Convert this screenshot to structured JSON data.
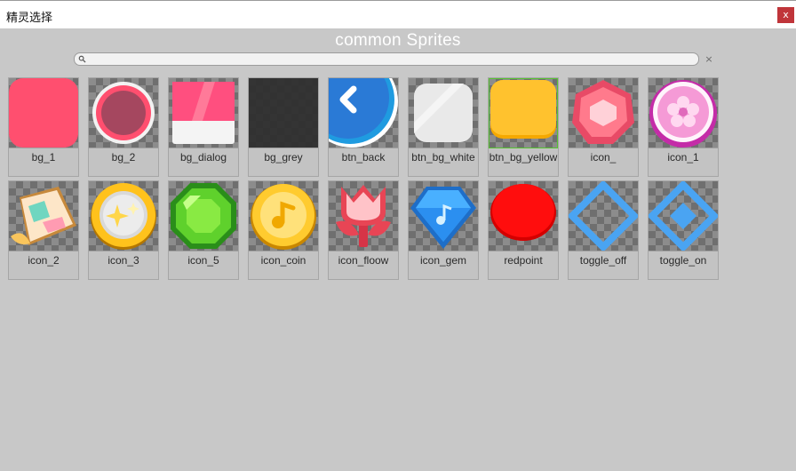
{
  "window": {
    "title": "精灵选择",
    "close_label": "x"
  },
  "heading": "common Sprites",
  "search": {
    "value": "",
    "clear_label": "×",
    "icon": "search-icon"
  },
  "sprites": [
    {
      "name": "bg_1",
      "icon": "bg-1-icon"
    },
    {
      "name": "bg_2",
      "icon": "bg-2-icon"
    },
    {
      "name": "bg_dialog",
      "icon": "bg-dialog-icon"
    },
    {
      "name": "bg_grey",
      "icon": "bg-grey-icon"
    },
    {
      "name": "btn_back",
      "icon": "back-arrow-icon"
    },
    {
      "name": "btn_bg_white",
      "icon": "btn-bg-white-icon"
    },
    {
      "name": "btn_bg_yellow",
      "icon": "btn-bg-yellow-icon",
      "selected": true
    },
    {
      "name": "icon_",
      "icon": "pink-gem-icon"
    },
    {
      "name": "icon_1",
      "icon": "flower-badge-icon"
    },
    {
      "name": "icon_2",
      "icon": "map-icon"
    },
    {
      "name": "icon_3",
      "icon": "sparkle-coin-icon"
    },
    {
      "name": "icon_5",
      "icon": "green-gem-icon"
    },
    {
      "name": "icon_coin",
      "icon": "coin-icon"
    },
    {
      "name": "icon_floow",
      "icon": "tulip-icon"
    },
    {
      "name": "icon_gem",
      "icon": "blue-diamond-icon"
    },
    {
      "name": "redpoint",
      "icon": "red-dot-icon"
    },
    {
      "name": "toggle_off",
      "icon": "toggle-off-icon"
    },
    {
      "name": "toggle_on",
      "icon": "toggle-on-icon"
    }
  ]
}
